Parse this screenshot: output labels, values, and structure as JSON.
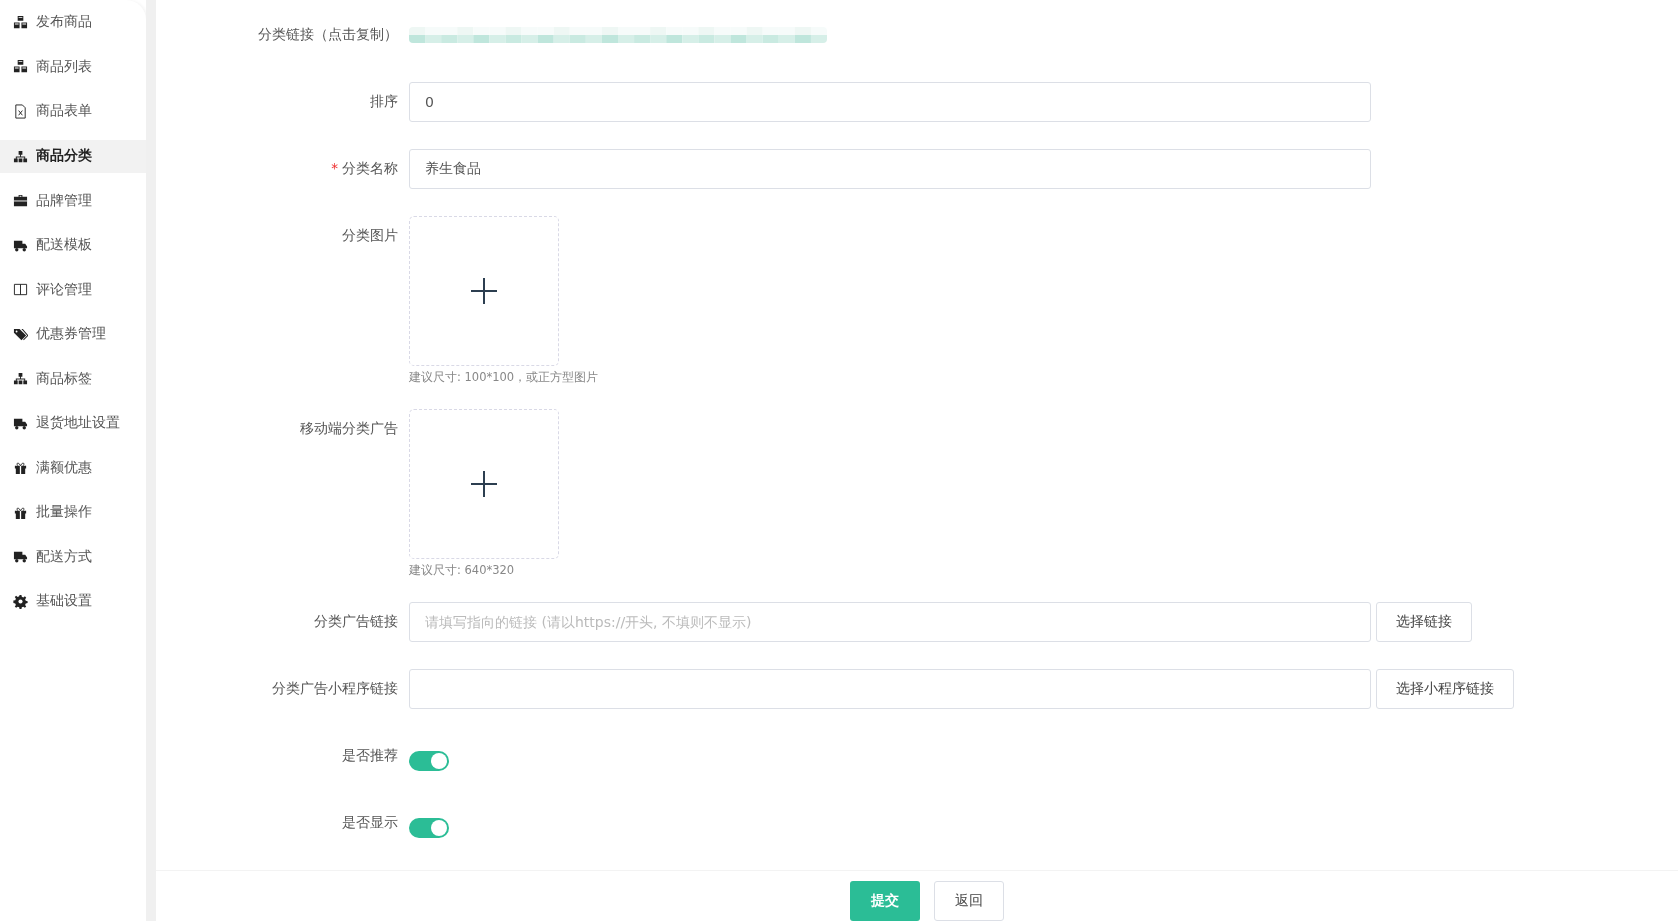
{
  "sidebar": {
    "items": [
      {
        "label": "发布商品",
        "kind": "cubes",
        "selected": false
      },
      {
        "label": "商品列表",
        "kind": "cubes",
        "selected": false
      },
      {
        "label": "商品表单",
        "kind": "file",
        "selected": false
      },
      {
        "label": "商品分类",
        "kind": "sitemap",
        "selected": true
      },
      {
        "label": "品牌管理",
        "kind": "briefcase",
        "selected": false
      },
      {
        "label": "配送模板",
        "kind": "truck",
        "selected": false
      },
      {
        "label": "评论管理",
        "kind": "columns",
        "selected": false
      },
      {
        "label": "优惠券管理",
        "kind": "tags",
        "selected": false
      },
      {
        "label": "商品标签",
        "kind": "sitemap",
        "selected": false
      },
      {
        "label": "退货地址设置",
        "kind": "truck",
        "selected": false
      },
      {
        "label": "满额优惠",
        "kind": "gift",
        "selected": false
      },
      {
        "label": "批量操作",
        "kind": "gift",
        "selected": false
      },
      {
        "label": "配送方式",
        "kind": "truck",
        "selected": false
      },
      {
        "label": "基础设置",
        "kind": "gear",
        "selected": false
      }
    ]
  },
  "form": {
    "fields": [
      {
        "kind": "link",
        "label": "分类链接（点击复制）"
      },
      {
        "kind": "input",
        "label": "排序",
        "value": "0"
      },
      {
        "kind": "input",
        "label": "分类名称",
        "value": "养生食品",
        "required_mark": "*"
      },
      {
        "kind": "upload",
        "label": "分类图片",
        "hint": "建议尺寸: 100*100，或正方型图片"
      },
      {
        "kind": "upload",
        "label": "移动端分类广告",
        "hint": "建议尺寸: 640*320"
      },
      {
        "kind": "input",
        "label": "分类广告链接",
        "placeholder": "请填写指向的链接 (请以https://开头, 不填则不显示)",
        "button": "选择链接"
      },
      {
        "kind": "input",
        "label": "分类广告小程序链接",
        "button": "选择小程序链接"
      },
      {
        "kind": "switch",
        "label": "是否推荐",
        "on": true
      },
      {
        "kind": "switch",
        "label": "是否显示",
        "on": true
      }
    ]
  },
  "footer": {
    "submit": "提交",
    "back": "返回"
  }
}
